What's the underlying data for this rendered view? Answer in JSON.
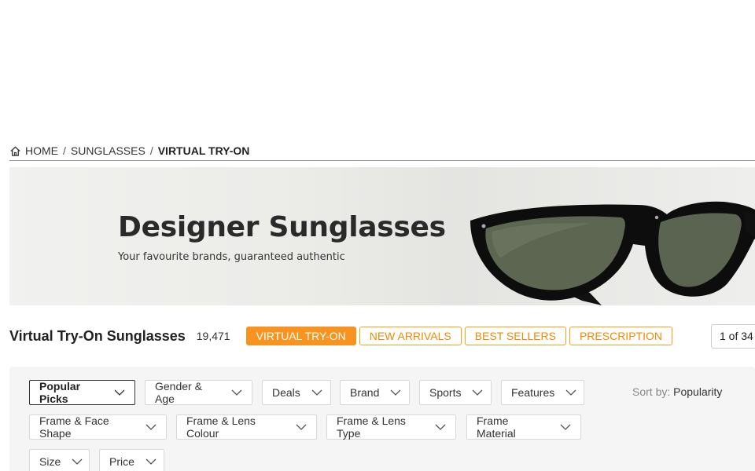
{
  "breadcrumb": {
    "items": [
      "HOME",
      "SUNGLASSES"
    ],
    "current": "VIRTUAL TRY-ON",
    "separator": "/"
  },
  "banner": {
    "title": "Designer Sunglasses",
    "subtitle": "Your favourite brands, guaranteed authentic"
  },
  "header": {
    "title": "Virtual Try-On Sunglasses",
    "count": "19,471",
    "chips": [
      {
        "label": "VIRTUAL TRY-ON",
        "active": true
      },
      {
        "label": "NEW ARRIVALS",
        "active": false
      },
      {
        "label": "BEST SELLERS",
        "active": false
      },
      {
        "label": "PRESCRIPTION",
        "active": false
      }
    ],
    "pager": "1 of 34"
  },
  "filters": {
    "row1": [
      "Popular Picks",
      "Gender & Age",
      "Deals",
      "Brand",
      "Sports",
      "Features"
    ],
    "row2": [
      "Frame & Face Shape",
      "Frame & Lens Colour",
      "Frame & Lens Type",
      "Frame Material"
    ],
    "row3": [
      "Size",
      "Price"
    ],
    "active": "Popular Picks"
  },
  "sort": {
    "label": "Sort by:",
    "value": "Popularity"
  },
  "colors": {
    "accent": "#f7931e",
    "accent_text": "#f08a00"
  },
  "icons": [
    "home-icon",
    "chevron-down-icon"
  ]
}
